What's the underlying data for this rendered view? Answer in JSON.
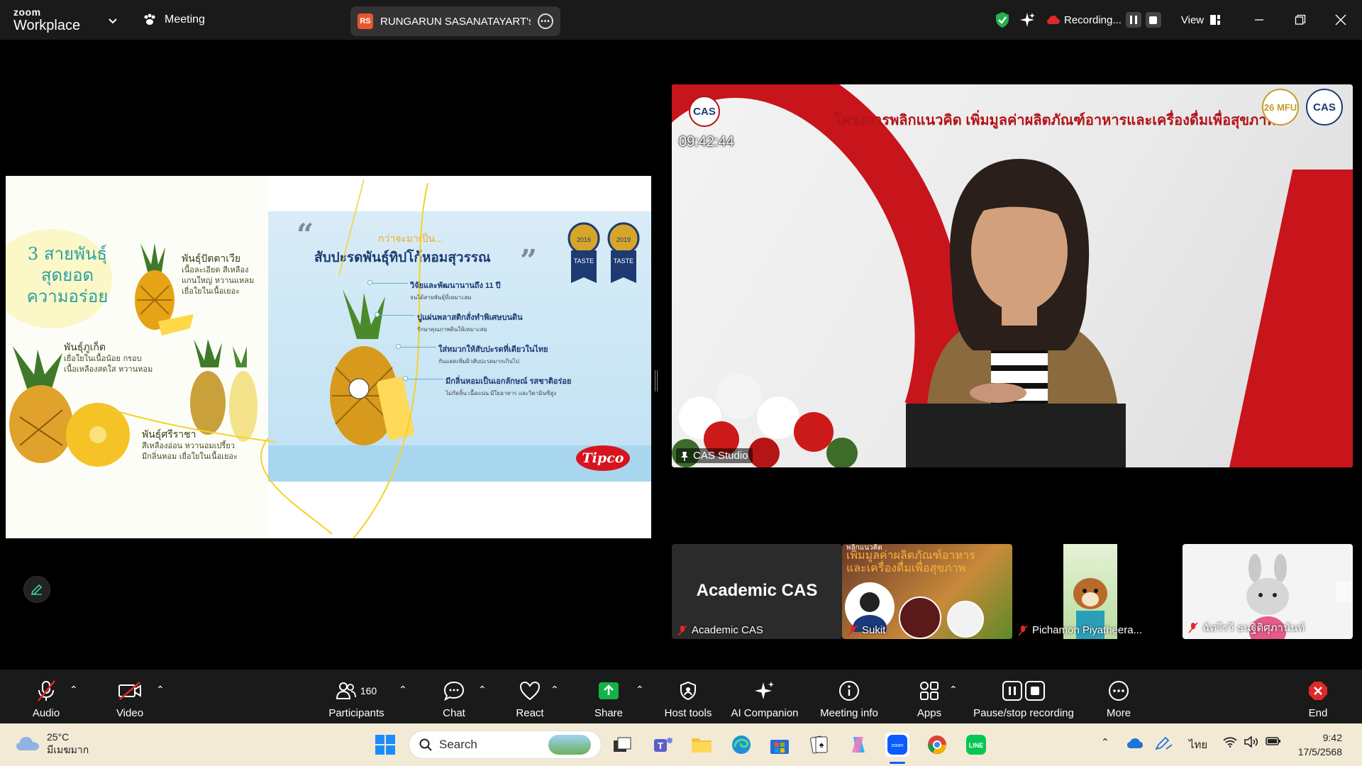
{
  "titlebar": {
    "logo_small": "zoom",
    "logo_big": "Workplace",
    "meeting_label": "Meeting",
    "share_badge": "RS",
    "share_name": "RUNGARUN SASANATAYART's sc",
    "recording_label": "Recording...",
    "view_label": "View"
  },
  "slide": {
    "left_title": "3 สายพันธุ์\nสุดยอด\nความอร่อย",
    "variety1_head": "พันธุ์ปัตตาเวีย",
    "variety1_body": "เนื้อละเอียด สีเหลือง\nแกนใหญ่ หวานแหลม\nเยื่อใยในเนื้อเยอะ",
    "variety2_head": "พันธุ์ภูเก็ต",
    "variety2_body": "เยื่อใยในเนื้อน้อย กรอบ\nเนื้อเหลืองสดใส หวานหอม",
    "variety3_head": "พันธุ์ศรีราชา",
    "variety3_body": "สีเหลืองอ่อน หวานอมเปรี้ยว\nมีกลิ่นหอม เยื่อใยในเนื้อเยอะ",
    "subheading": "กว่าจะมาเป็น...",
    "heading": "สับปะรดพันธุ์ทิปโก้หอมสุวรรณ",
    "medal1_year": "2016",
    "medal2_year": "2019",
    "medal_text": "TASTE",
    "bullets": [
      {
        "t": "วิจัยและพัฒนานานถึง 11 ปี",
        "s": "จนได้สายพันธุ์ที่เหมาะสม"
      },
      {
        "t": "ปูแผ่นพลาสติกสั่งทำพิเศษบนดิน",
        "s": "รักษาคุณภาพดินให้เหมาะสม"
      },
      {
        "t": "ใส่หมวกให้สับปะรดที่เดียวในไทย",
        "s": "กันแดดเพิ่มผิวสับปะรดมากเกินไป"
      },
      {
        "t": "มีกลิ่นหอมเป็นเอกลักษณ์ รสชาติอร่อย",
        "s": "ไม่กัดลิ้น เนื้อแน่น มีใยอาหาร และวิตามินซีสูง"
      }
    ],
    "brand": "Tipco"
  },
  "speaker": {
    "banner": "โครงการพลิกแนวคิด เพิ่มมูลค่าผลิตภัณฑ์อาหารและเครื่องดื่มเพื่อสุขภาพ",
    "cas_logo": "CAS",
    "clock": "09:42:44",
    "logo_mfu": "26 MFU",
    "logo_cas": "CAS",
    "name": "CAS Studio"
  },
  "thumbnails": [
    {
      "title": "Academic CAS",
      "name": "Academic CAS"
    },
    {
      "overlay": "เพิ่มมูลค่าผลิตภัณฑ์อาหาร\nและเครื่องดื่มเพื่อสุขภาพ",
      "overlay_top": "พลิกแนวคิด",
      "name": "Sukit"
    },
    {
      "name": "Pichamon Piyatheera..."
    },
    {
      "name": "ฉัตรีรวี ธนฐิติศุภานันท์"
    }
  ],
  "toolbar": {
    "audio": "Audio",
    "video": "Video",
    "participants_count": "160",
    "participants": "Participants",
    "chat": "Chat",
    "react": "React",
    "share": "Share",
    "host_tools": "Host tools",
    "ai_companion": "AI Companion",
    "meeting_info": "Meeting info",
    "apps": "Apps",
    "pause_stop": "Pause/stop recording",
    "more": "More",
    "end": "End"
  },
  "taskbar": {
    "temp": "25°C",
    "weather": "มีเมฆมาก",
    "search": "Search",
    "lang": "ไทย",
    "time": "9:42",
    "date": "17/5/2568"
  },
  "colors": {
    "zoom_blue": "#0b5cff",
    "record_red": "#e02828",
    "share_green": "#12b347",
    "end_red": "#e02828",
    "cas_red": "#c8141b"
  }
}
